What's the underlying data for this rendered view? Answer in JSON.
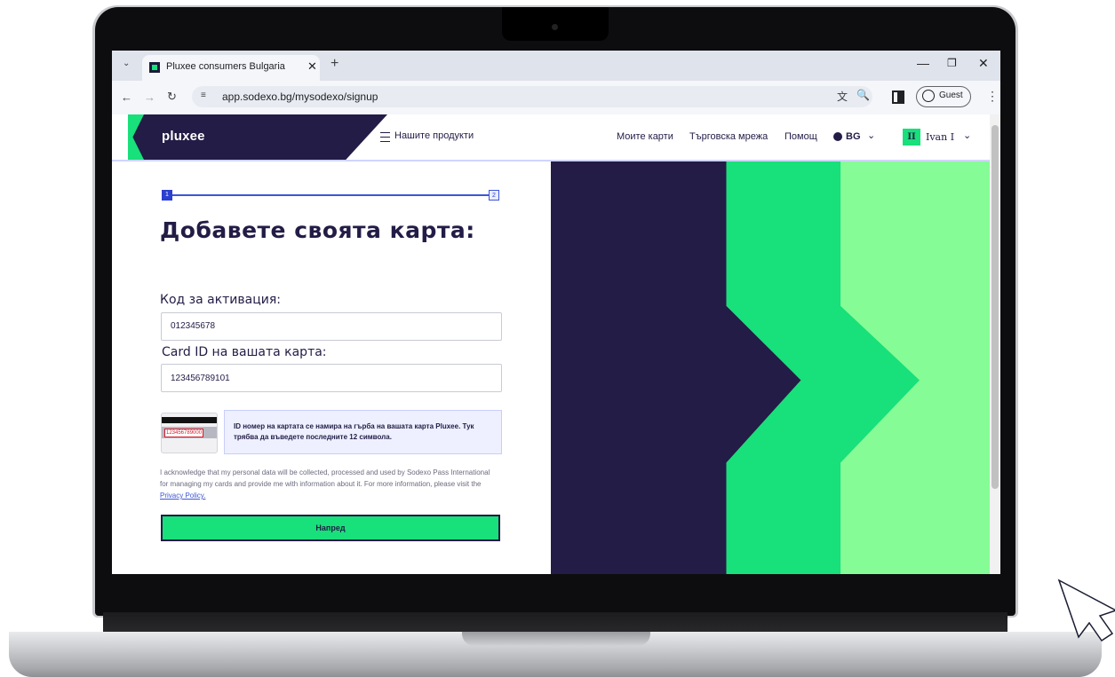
{
  "browser": {
    "tab_title": "Pluxee consumers Bulgaria",
    "url": "app.sodexo.bg/mysodexo/signup",
    "profile_label": "Guest"
  },
  "header": {
    "logo": "pluxee",
    "products": "Нашите продукти",
    "nav": [
      "Моите карти",
      "Търговска мрежа",
      "Помощ"
    ],
    "language": "BG",
    "user_initials": "II",
    "user_name": "Ivan I"
  },
  "stepper": {
    "current": "1",
    "next": "2"
  },
  "form": {
    "title": "Добавете своята карта:",
    "activation_label": "Код за активация:",
    "activation_value": "012345678",
    "card_id_label": "Card ID на вашата карта:",
    "card_id_value": "123456789101",
    "card_image_number": "123456789000",
    "hint": "ID номер на картата се намира на гърба на вашата карта Pluxee. Тук трябва да въведете последните 12 символа.",
    "consent_text": "I acknowledge that my personal data will be collected, processed and used by Sodexo Pass International for managing my cards and provide me with information about it. For more information, please visit the",
    "privacy_link": "Privacy Policy.",
    "next_button": "Напред"
  },
  "colors": {
    "brand_dark": "#221c46",
    "brand_green": "#18e07a",
    "light_green": "#86fc96",
    "accent_blue": "#3d56d6"
  }
}
